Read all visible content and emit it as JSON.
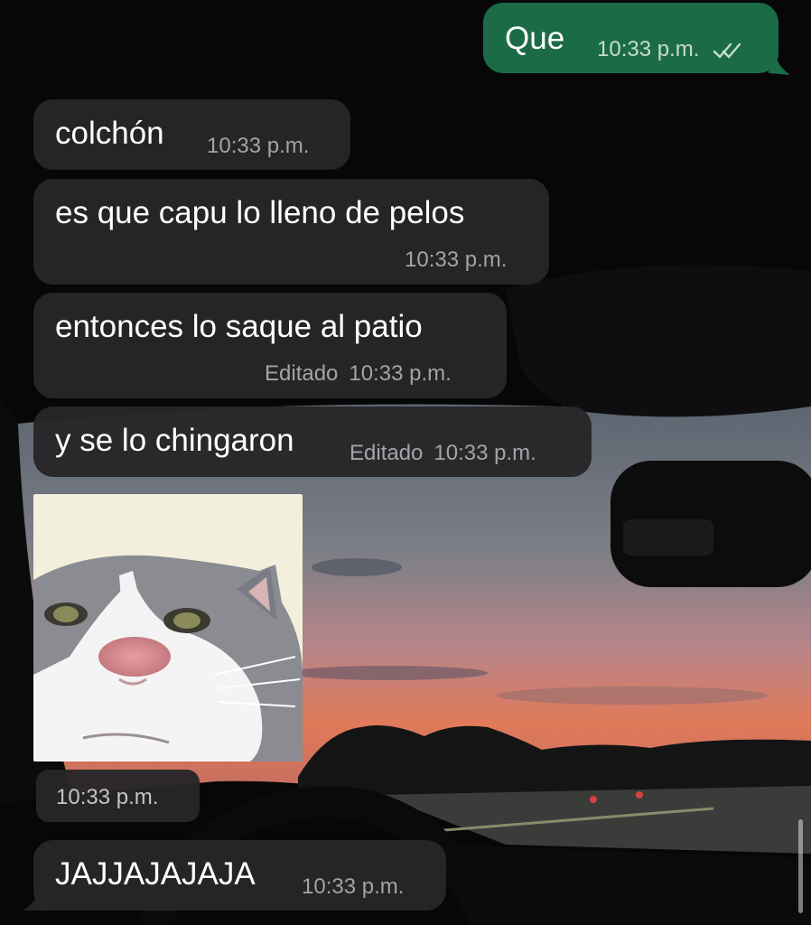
{
  "colors": {
    "outgoing_bubble": "#1b6b47",
    "incoming_bubble": "#262628",
    "meta_text": "#a3a3a8",
    "read_ticks": "#c7dccf"
  },
  "messages": [
    {
      "direction": "outgoing",
      "text": "Que",
      "time": "10:33 p.m.",
      "status_icon": "double-check-icon"
    },
    {
      "direction": "incoming",
      "text": "colchón",
      "time": "10:33 p.m."
    },
    {
      "direction": "incoming",
      "text": "es que capu lo lleno de pelos",
      "time": "10:33 p.m."
    },
    {
      "direction": "incoming",
      "text": "entonces lo saque al patio",
      "edited": "Editado",
      "time": "10:33 p.m."
    },
    {
      "direction": "incoming",
      "text": "y se lo chingaron",
      "edited": "Editado",
      "time": "10:33 p.m."
    },
    {
      "direction": "incoming",
      "type": "image",
      "image_icon": "cat-selfie-photo",
      "time": "10:33 p.m."
    },
    {
      "direction": "incoming",
      "text": "JAJJAJAJAJA",
      "time": "10:33 p.m."
    }
  ]
}
